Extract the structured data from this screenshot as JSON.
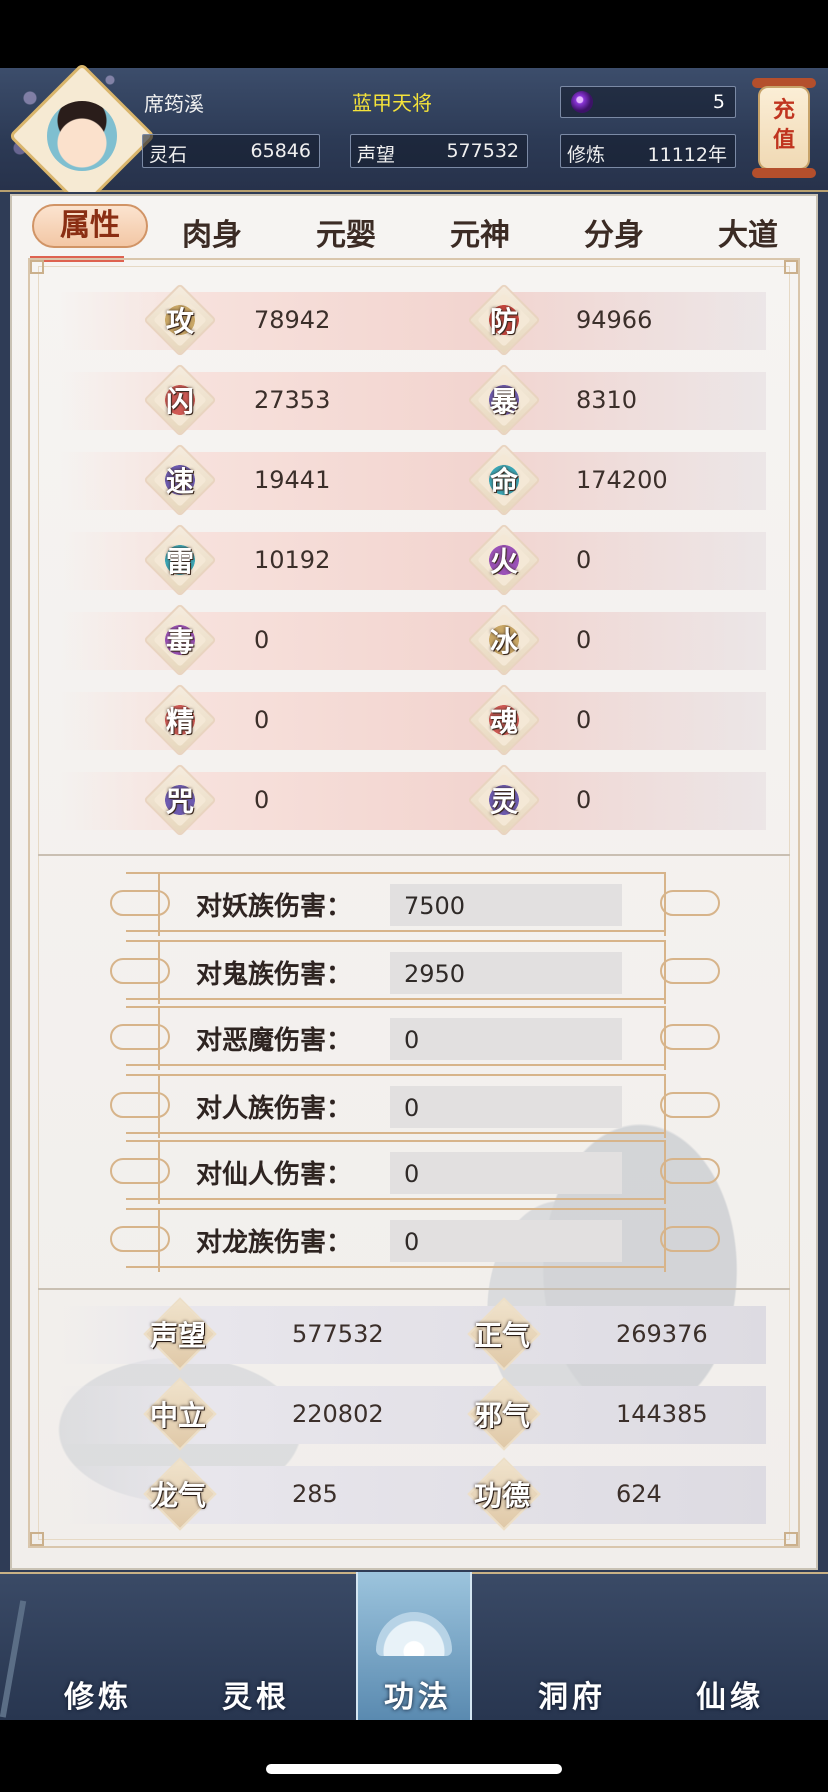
{
  "header": {
    "player_name": "席筠溪",
    "player_title": "蓝甲天将",
    "gem_value": "5",
    "spirit_stone": {
      "label": "灵石",
      "value": "65846"
    },
    "reputation": {
      "label": "声望",
      "value": "577532"
    },
    "cultivation": {
      "label": "修炼",
      "value": "11112年"
    },
    "recharge_label": "充值"
  },
  "tabs": [
    "属性",
    "肉身",
    "元婴",
    "元神",
    "分身",
    "大道"
  ],
  "attributes": [
    {
      "left": {
        "glyph": "攻",
        "value": "78942"
      },
      "right": {
        "glyph": "防",
        "value": "94966"
      }
    },
    {
      "left": {
        "glyph": "闪",
        "value": "27353"
      },
      "right": {
        "glyph": "暴",
        "value": "8310"
      }
    },
    {
      "left": {
        "glyph": "速",
        "value": "19441"
      },
      "right": {
        "glyph": "命",
        "value": "174200"
      }
    },
    {
      "left": {
        "glyph": "雷",
        "value": "10192"
      },
      "right": {
        "glyph": "火",
        "value": "0"
      }
    },
    {
      "left": {
        "glyph": "毒",
        "value": "0"
      },
      "right": {
        "glyph": "冰",
        "value": "0"
      }
    },
    {
      "left": {
        "glyph": "精",
        "value": "0"
      },
      "right": {
        "glyph": "魂",
        "value": "0"
      }
    },
    {
      "left": {
        "glyph": "咒",
        "value": "0"
      },
      "right": {
        "glyph": "灵",
        "value": "0"
      }
    }
  ],
  "attribute_colors": {
    "gold": "#c9a766",
    "red": "#c8463e",
    "purple": "#6d5bb0",
    "teal": "#3aa6b5",
    "violet": "#9b52b8",
    "crimson": "#d05a55"
  },
  "damage": [
    {
      "label": "对妖族伤害：",
      "value": "7500"
    },
    {
      "label": "对鬼族伤害：",
      "value": "2950"
    },
    {
      "label": "对恶魔伤害：",
      "value": "0"
    },
    {
      "label": "对人族伤害：",
      "value": "0"
    },
    {
      "label": "对仙人伤害：",
      "value": "0"
    },
    {
      "label": "对龙族伤害：",
      "value": "0"
    }
  ],
  "reputation_stats": [
    {
      "left": {
        "label": "声望",
        "value": "577532"
      },
      "right": {
        "label": "正气",
        "value": "269376"
      }
    },
    {
      "left": {
        "label": "中立",
        "value": "220802"
      },
      "right": {
        "label": "邪气",
        "value": "144385"
      }
    },
    {
      "left": {
        "label": "龙气",
        "value": "285"
      },
      "right": {
        "label": "功德",
        "value": "624"
      }
    }
  ],
  "nav": [
    "修炼",
    "灵根",
    "功法",
    "洞府",
    "仙缘"
  ],
  "active_nav": "功法",
  "colors": {
    "accent": "#de6250",
    "header_bg": "#2c3a55",
    "title_yellow": "#f5e33a"
  }
}
